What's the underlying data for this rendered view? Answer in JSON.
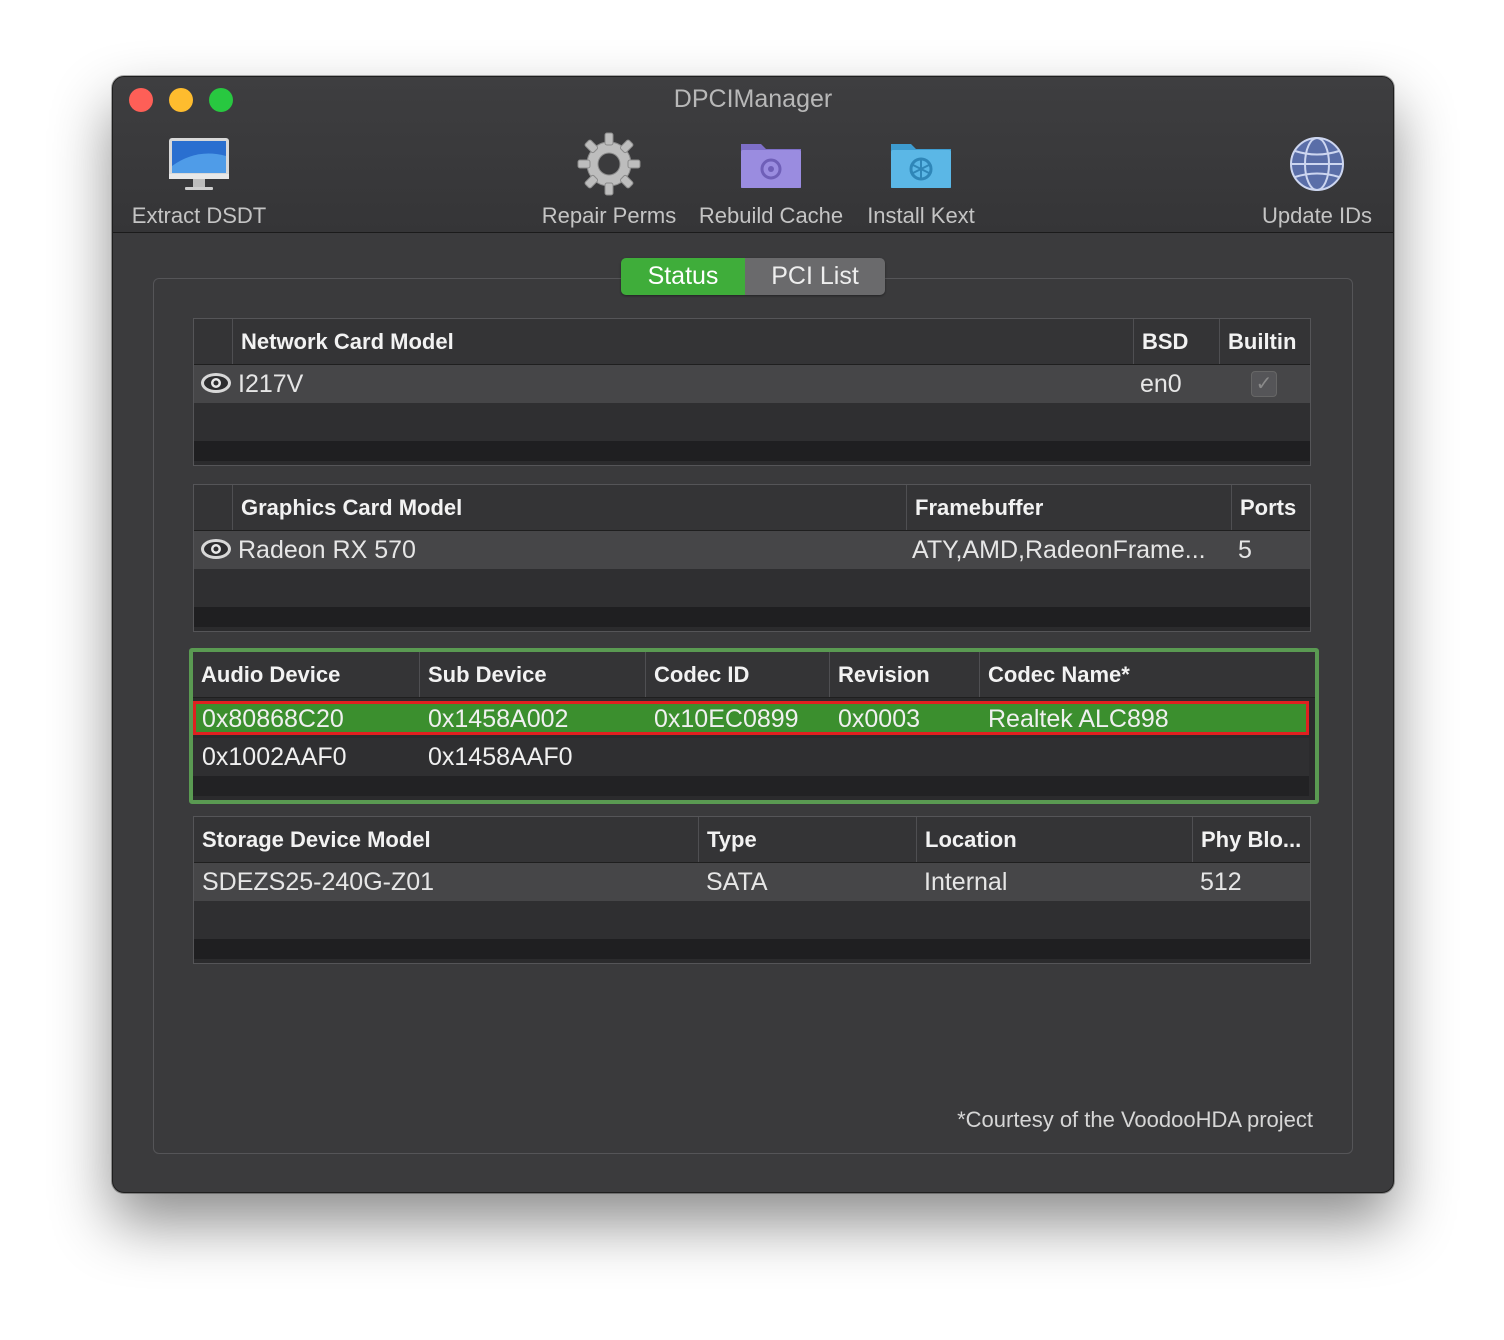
{
  "window": {
    "title": "DPCIManager"
  },
  "toolbar": {
    "extract_dsdt": "Extract DSDT",
    "repair_perms": "Repair Perms",
    "rebuild_cache": "Rebuild Cache",
    "install_kext": "Install Kext",
    "update_ids": "Update IDs"
  },
  "tabs": {
    "status": "Status",
    "pci_list": "PCI List",
    "active": "Status"
  },
  "network": {
    "headers": {
      "model": "Network Card Model",
      "bsd": "BSD",
      "builtin": "Builtin"
    },
    "rows": [
      {
        "model": "I217V",
        "bsd": "en0",
        "builtin": true
      }
    ]
  },
  "graphics": {
    "headers": {
      "model": "Graphics Card Model",
      "framebuffer": "Framebuffer",
      "ports": "Ports"
    },
    "rows": [
      {
        "model": "Radeon RX 570",
        "framebuffer": "ATY,AMD,RadeonFrame...",
        "ports": "5"
      }
    ]
  },
  "audio": {
    "headers": {
      "device": "Audio Device",
      "sub": "Sub Device",
      "codec_id": "Codec ID",
      "revision": "Revision",
      "codec_name": "Codec Name*"
    },
    "rows": [
      {
        "device": "0x80868C20",
        "sub": "0x1458A002",
        "codec_id": "0x10EC0899",
        "revision": "0x0003",
        "codec_name": "Realtek ALC898"
      },
      {
        "device": "0x1002AAF0",
        "sub": "0x1458AAF0",
        "codec_id": "",
        "revision": "",
        "codec_name": ""
      }
    ]
  },
  "storage": {
    "headers": {
      "model": "Storage Device Model",
      "type": "Type",
      "location": "Location",
      "phy": "Phy Blo..."
    },
    "rows": [
      {
        "model": "SDEZS25-240G-Z01",
        "type": "SATA",
        "location": "Internal",
        "phy": "512"
      }
    ]
  },
  "footnote": "*Courtesy of the VoodooHDA project",
  "colors": {
    "accent_green": "#3fad3a",
    "selection_green": "#3b8f2e",
    "highlight_border": "#5a9a52",
    "selection_outline": "#e02020"
  }
}
